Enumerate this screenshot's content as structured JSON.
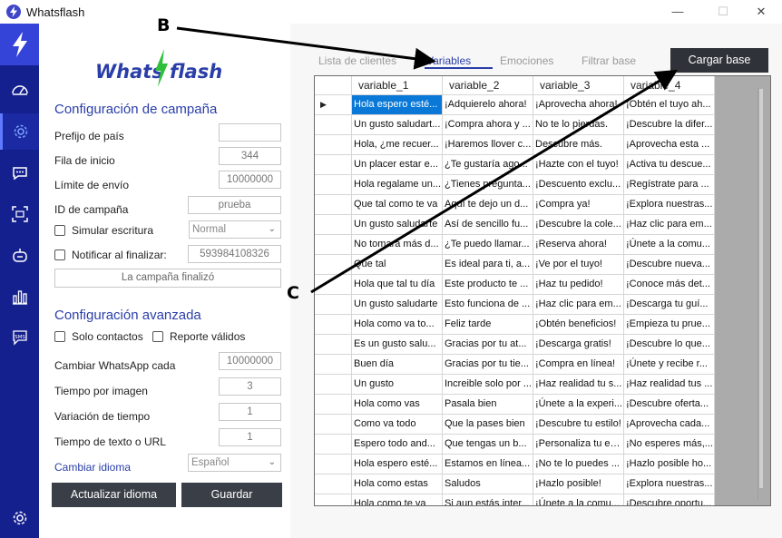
{
  "window": {
    "title": "Whatsflash",
    "controls": {
      "minimize": "—",
      "maximize": "☐",
      "close": "✕"
    }
  },
  "nav": {
    "items": [
      "lightning-icon",
      "dashboard-icon",
      "settings-icon",
      "chat-icon",
      "scan-icon",
      "bot-icon",
      "stats-icon",
      "sms-icon",
      "gear-bottom-icon"
    ],
    "active": "settings-icon",
    "brand_color": "#15208f"
  },
  "logo": {
    "part1": "Whats",
    "part2": "flash"
  },
  "campaign": {
    "title": "Configuración de campaña",
    "country_prefix_label": "Prefijo de país",
    "country_prefix_value": "",
    "start_row_label": "Fila de inicio",
    "start_row_value": "344",
    "send_limit_label": "Límite de envío",
    "send_limit_value": "10000000",
    "campaign_id_label": "ID de campaña",
    "campaign_id_value": "prueba",
    "simulate_typing_label": "Simular escritura",
    "typing_mode_value": "Normal",
    "notify_label": "Notificar al finalizar:",
    "notify_value": "593984108326",
    "status_text": "La campaña finalizó"
  },
  "advanced": {
    "title": "Configuración avanzada",
    "only_contacts_label": "Solo contactos",
    "valid_report_label": "Reporte válidos",
    "change_whatsapp_label": "Cambiar WhatsApp cada",
    "change_whatsapp_value": "10000000",
    "time_per_image_label": "Tiempo por imagen",
    "time_per_image_value": "3",
    "time_variation_label": "Variación de tiempo",
    "time_variation_value": "1",
    "text_url_time_label": "Tiempo de texto o URL",
    "text_url_time_value": "1",
    "language_link": "Cambiar idioma",
    "language_value": "Español"
  },
  "buttons": {
    "update_language": "Actualizar idioma",
    "save": "Guardar",
    "load_base": "Cargar base"
  },
  "tabs": [
    "Lista de clientes",
    "Variables",
    "Emociones",
    "Filtrar base"
  ],
  "active_tab": "Variables",
  "table": {
    "columns": [
      "variable_1",
      "variable_2",
      "variable_3",
      "variable_4"
    ],
    "rows": [
      [
        "Hola espero esté...",
        "¡Adquierelo ahora!",
        "¡Aprovecha ahora!",
        "¡Obtén el tuyo ah..."
      ],
      [
        "Un gusto saludart...",
        "¡Compra ahora y ...",
        "No te lo pierdas.",
        "¡Descubre la difer..."
      ],
      [
        "Hola, ¿me recuer...",
        "¡Haremos llover c...",
        "Descubre más.",
        "¡Aprovecha esta ..."
      ],
      [
        "Un placer estar e...",
        "¿Te gustaría ago...",
        "¡Hazte con el tuyo!",
        "¡Activa tu descue..."
      ],
      [
        "Hola regalame un...",
        "¿Tienes pregunta...",
        "¡Descuento exclu...",
        "¡Regístrate para ..."
      ],
      [
        "Que tal como te va",
        "Aquí te dejo un d...",
        "¡Compra ya!",
        "¡Explora nuestras..."
      ],
      [
        "Un gusto saludarte",
        "Así de sencillo fu...",
        "¡Descubre la cole...",
        "¡Haz clic para em..."
      ],
      [
        "No tomara más d...",
        "¿Te puedo llamar...",
        "¡Reserva ahora!",
        "¡Únete a la comu..."
      ],
      [
        "Que tal",
        "Es ideal para ti, a...",
        "¡Ve por el tuyo!",
        "¡Descubre nueva..."
      ],
      [
        "Hola que tal tu día",
        "Este producto te ...",
        "¡Haz tu pedido!",
        "¡Conoce más det..."
      ],
      [
        "Un gusto saludarte",
        "Esto funciona de ...",
        "¡Haz clic para em...",
        "¡Descarga tu guí..."
      ],
      [
        "Hola como va to...",
        "Feliz tarde",
        "¡Obtén beneficios!",
        "¡Empieza tu prue..."
      ],
      [
        "Es un gusto salu...",
        "Gracias por tu at...",
        "¡Descarga gratis!",
        "¡Descubre lo que..."
      ],
      [
        "Buen día",
        "Gracias por tu tie...",
        "¡Compra en línea!",
        "¡Únete y recibe r..."
      ],
      [
        "Un gusto",
        "Increible solo por ...",
        "¡Haz realidad tu s...",
        "¡Haz realidad tus ..."
      ],
      [
        "Hola como vas",
        "Pasala bien",
        "¡Únete a la experi...",
        "¡Descubre oferta..."
      ],
      [
        "Como va todo",
        "Que la pases bien",
        "¡Descubre tu estilo!",
        "¡Aprovecha cada..."
      ],
      [
        "Espero todo and...",
        "Que tengas un b...",
        "¡Personaliza tu ex...",
        "¡No esperes más,..."
      ],
      [
        "Hola espero esté...",
        "Estamos en línea...",
        "¡No te lo puedes ...",
        "¡Hazlo posible ho..."
      ],
      [
        "Hola como estas",
        "Saludos",
        "¡Hazlo posible!",
        "¡Explora nuestras..."
      ],
      [
        "Hola como te va",
        "Si aun estás inter...",
        "¡Únete a la comu...",
        "¡Descubre oportu..."
      ]
    ]
  },
  "annotations": {
    "b": "B",
    "c": "C"
  },
  "colors": {
    "accent": "#2a3ea8",
    "selected": "#0a78d7",
    "button_dark": "#3a3f47",
    "logo_green": "#2fbf3a"
  }
}
